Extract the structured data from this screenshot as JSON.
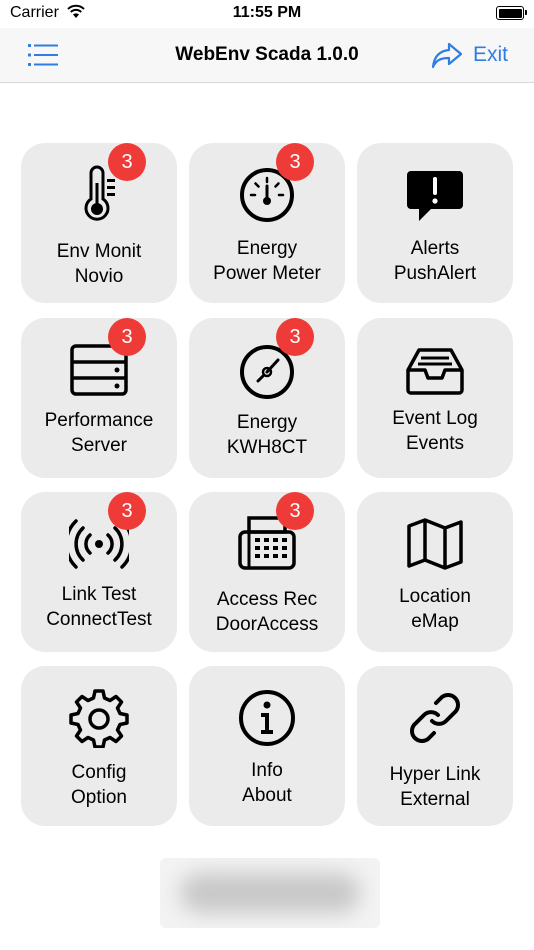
{
  "status_bar": {
    "carrier": "Carrier",
    "time": "11:55 PM"
  },
  "nav": {
    "title": "WebEnv Scada 1.0.0",
    "exit_label": "Exit",
    "accent_color": "#2f7de1"
  },
  "badge_color": "#ee3b37",
  "tiles": [
    {
      "line1": "Env Monit",
      "line2": "Novio",
      "icon": "thermometer-icon",
      "badge": "3"
    },
    {
      "line1": "Energy",
      "line2": "Power Meter",
      "icon": "gauge-icon",
      "badge": "3"
    },
    {
      "line1": "Alerts",
      "line2": "PushAlert",
      "icon": "alert-bubble-icon",
      "badge": ""
    },
    {
      "line1": "Performance",
      "line2": "Server",
      "icon": "server-icon",
      "badge": "3"
    },
    {
      "line1": "Energy",
      "line2": "KWH8CT",
      "icon": "compass-icon",
      "badge": "3"
    },
    {
      "line1": "Event Log",
      "line2": "Events",
      "icon": "inbox-icon",
      "badge": ""
    },
    {
      "line1": "Link Test",
      "line2": "ConnectTest",
      "icon": "broadcast-icon",
      "badge": "3"
    },
    {
      "line1": "Access Rec",
      "line2": "DoorAccess",
      "icon": "fax-icon",
      "badge": "3"
    },
    {
      "line1": "Location",
      "line2": "eMap",
      "icon": "map-icon",
      "badge": ""
    },
    {
      "line1": "Config",
      "line2": "Option",
      "icon": "gear-icon",
      "badge": ""
    },
    {
      "line1": "Info",
      "line2": "About",
      "icon": "info-icon",
      "badge": ""
    },
    {
      "line1": "Hyper Link",
      "line2": "External",
      "icon": "link-icon",
      "badge": ""
    }
  ]
}
